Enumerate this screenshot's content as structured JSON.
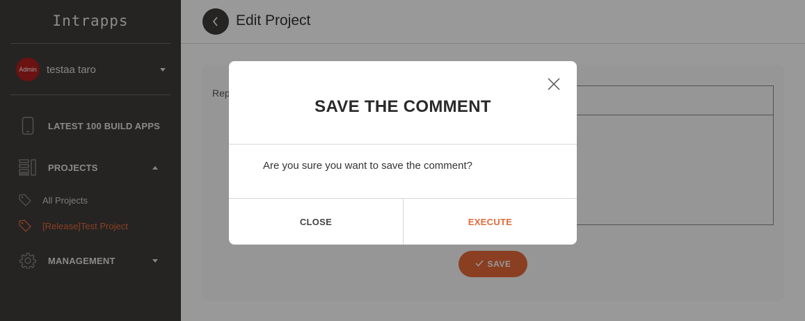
{
  "app": {
    "brand": "Intrapps"
  },
  "user": {
    "avatar_label": "Admin",
    "name": "testaa taro",
    "avatar_color": "#b21f1f"
  },
  "sidebar": {
    "items": [
      {
        "label": "LATEST 100 BUILD APPS",
        "icon": "phone-icon"
      },
      {
        "label": "PROJECTS",
        "icon": "list-icon",
        "expanded": true,
        "children": [
          {
            "label": "All Projects",
            "icon": "tag-icon",
            "active": false
          },
          {
            "label": "[Release]Test Project",
            "icon": "tag-icon",
            "active": true
          }
        ]
      },
      {
        "label": "MANAGEMENT",
        "icon": "gear-icon"
      }
    ]
  },
  "header": {
    "title": "Edit Project",
    "back_icon": "chevron-left-icon"
  },
  "form": {
    "label_partial": "Rep",
    "save_label": "SAVE"
  },
  "modal": {
    "title": "SAVE THE COMMENT",
    "message": "Are you sure you want to save the comment?",
    "close_label": "CLOSE",
    "execute_label": "EXECUTE"
  },
  "colors": {
    "accent": "#e66a3a",
    "sidebar_bg": "#3f3c39"
  }
}
